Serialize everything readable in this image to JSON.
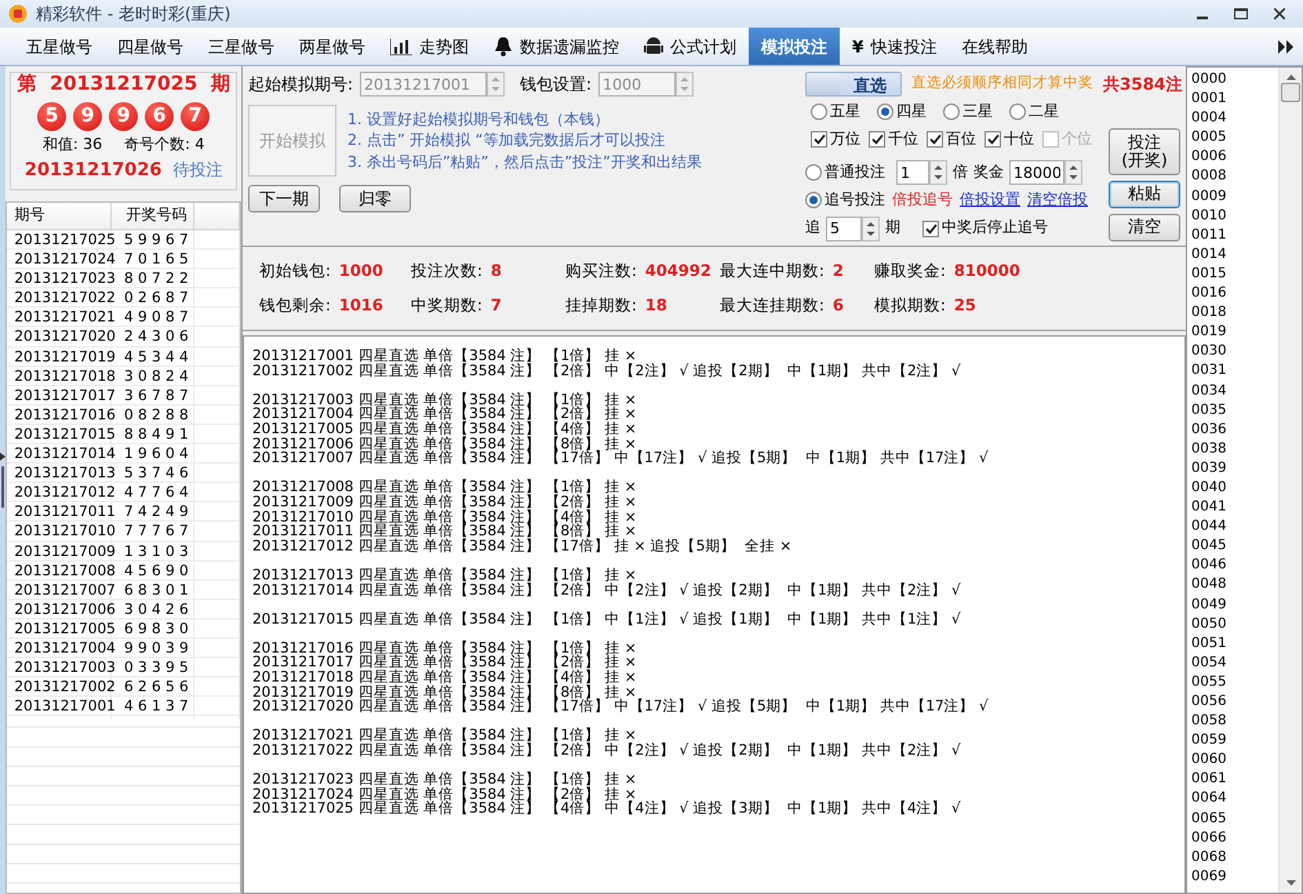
{
  "window": {
    "title": "精彩软件 - 老时时彩(重庆)"
  },
  "menu": [
    {
      "label": "五星做号",
      "kind": "text",
      "selected": false
    },
    {
      "label": "四星做号",
      "kind": "text",
      "selected": false
    },
    {
      "label": "三星做号",
      "kind": "text",
      "selected": false
    },
    {
      "label": "两星做号",
      "kind": "text",
      "selected": false
    },
    {
      "label": "走势图",
      "kind": "chart",
      "selected": false
    },
    {
      "label": "数据遗漏监控",
      "kind": "bell",
      "selected": false
    },
    {
      "label": "公式计划",
      "kind": "robot",
      "selected": false
    },
    {
      "label": "模拟投注",
      "kind": "text",
      "selected": true
    },
    {
      "label": "快速投注",
      "kind": "glyph",
      "glyph": "¥",
      "selected": false
    },
    {
      "label": "在线帮助",
      "kind": "text",
      "selected": false
    }
  ],
  "draw": {
    "prefix": "第",
    "period": "20131217025",
    "suffix": "期",
    "balls": [
      "5",
      "9",
      "9",
      "6",
      "7"
    ],
    "sum_label": "和值:",
    "sum": "36",
    "odd_label": "奇号个数:",
    "odd": "4",
    "next_period": "20131217026",
    "next_status": "待投注"
  },
  "history": {
    "columns": [
      "期号",
      "开奖号码"
    ],
    "rows": [
      {
        "period": "20131217025",
        "numbers": "5 9 9 6 7"
      },
      {
        "period": "20131217024",
        "numbers": "7 0 1 6 5"
      },
      {
        "period": "20131217023",
        "numbers": "8 0 7 2 2"
      },
      {
        "period": "20131217022",
        "numbers": "0 2 6 8 7"
      },
      {
        "period": "20131217021",
        "numbers": "4 9 0 8 7"
      },
      {
        "period": "20131217020",
        "numbers": "2 4 3 0 6"
      },
      {
        "period": "20131217019",
        "numbers": "4 5 3 4 4"
      },
      {
        "period": "20131217018",
        "numbers": "3 0 8 2 4"
      },
      {
        "period": "20131217017",
        "numbers": "3 6 7 8 7"
      },
      {
        "period": "20131217016",
        "numbers": "0 8 2 8 8"
      },
      {
        "period": "20131217015",
        "numbers": "8 8 4 9 1"
      },
      {
        "period": "20131217014",
        "numbers": "1 9 6 0 4"
      },
      {
        "period": "20131217013",
        "numbers": "5 3 7 4 6"
      },
      {
        "period": "20131217012",
        "numbers": "4 7 7 6 4"
      },
      {
        "period": "20131217011",
        "numbers": "7 4 2 4 9"
      },
      {
        "period": "20131217010",
        "numbers": "7 7 7 6 7"
      },
      {
        "period": "20131217009",
        "numbers": "1 3 1 0 3"
      },
      {
        "period": "20131217008",
        "numbers": "4 5 6 9 0"
      },
      {
        "period": "20131217007",
        "numbers": "6 8 3 0 1"
      },
      {
        "period": "20131217006",
        "numbers": "3 0 4 2 6"
      },
      {
        "period": "20131217005",
        "numbers": "6 9 8 3 0"
      },
      {
        "period": "20131217004",
        "numbers": "9 9 0 3 9"
      },
      {
        "period": "20131217003",
        "numbers": "0 3 3 9 5"
      },
      {
        "period": "20131217002",
        "numbers": "6 2 6 5 6"
      },
      {
        "period": "20131217001",
        "numbers": "4 6 1 3 7"
      }
    ]
  },
  "settings": {
    "start_period": {
      "label": "起始模拟期号:",
      "value": "20131217001",
      "disabled": true
    },
    "wallet": {
      "label": "钱包设置:",
      "value": "1000",
      "disabled": true
    },
    "start_button": {
      "label": "开始模拟",
      "disabled": true
    },
    "instructions": [
      "1. 设置好起始模拟期号和钱包（本钱）",
      "2. 点击” 开始模拟 “等加载完数据后才可以投注",
      "3. 杀出号码后”粘贴”，然后点击”投注”开奖和出结果"
    ],
    "next_button": "下一期",
    "reset_button": "归零",
    "mode": {
      "label": "直选",
      "selected": true
    },
    "note": "直选必须顺序相同才算中奖",
    "total": "共3584注",
    "stars": [
      {
        "label": "五星",
        "selected": false
      },
      {
        "label": "四星",
        "selected": true
      },
      {
        "label": "三星",
        "selected": false
      },
      {
        "label": "二星",
        "selected": false
      }
    ],
    "positions": [
      {
        "label": "万位",
        "checked": true,
        "disabled": false
      },
      {
        "label": "千位",
        "checked": true,
        "disabled": false
      },
      {
        "label": "百位",
        "checked": true,
        "disabled": false
      },
      {
        "label": "十位",
        "checked": true,
        "disabled": false
      },
      {
        "label": "个位",
        "checked": false,
        "disabled": true
      }
    ],
    "normal_bet": {
      "label": "普通投注",
      "selected": false,
      "multiplier": "1",
      "times": "倍",
      "prize_label": "奖金",
      "prize": "18000"
    },
    "chase_bet": {
      "label": "追号投注",
      "selected": true,
      "links": [
        {
          "label": "倍投追号",
          "kind": "red"
        },
        {
          "label": "倍投设置",
          "kind": "blue"
        },
        {
          "label": "清空倍投",
          "kind": "blue"
        }
      ]
    },
    "chase": {
      "prefix": "追",
      "value": "5",
      "suffix": "期"
    },
    "stop_on_win": {
      "label": "中奖后停止追号",
      "checked": true
    },
    "buttons": [
      {
        "label": "投注\n(开奖)",
        "focused": false
      },
      {
        "label": "粘贴",
        "focused": true
      },
      {
        "label": "清空",
        "focused": false
      }
    ]
  },
  "stats": [
    {
      "label": "初始钱包:",
      "value": "1000"
    },
    {
      "label": "投注次数:",
      "value": "8"
    },
    {
      "label": "购买注数:",
      "value": "404992"
    },
    {
      "label": "最大连中期数:",
      "value": "2"
    },
    {
      "label": "赚取奖金:",
      "value": "810000"
    },
    {
      "label": "钱包剩余:",
      "value": "1016"
    },
    {
      "label": "中奖期数:",
      "value": "7"
    },
    {
      "label": "挂掉期数:",
      "value": "18"
    },
    {
      "label": "最大连挂期数:",
      "value": "6"
    },
    {
      "label": "模拟期数:",
      "value": "25"
    }
  ],
  "log": [
    [
      "20131217001 四星直选 单倍【3584 注】 【1倍】 挂 ×",
      "20131217002 四星直选 单倍【3584 注】 【2倍】 中【2注】 √ 追投【2期】  中【1期】 共中【2注】 √"
    ],
    [
      "20131217003 四星直选 单倍【3584 注】 【1倍】 挂 ×",
      "20131217004 四星直选 单倍【3584 注】 【2倍】 挂 ×",
      "20131217005 四星直选 单倍【3584 注】 【4倍】 挂 ×",
      "20131217006 四星直选 单倍【3584 注】 【8倍】 挂 ×",
      "20131217007 四星直选 单倍【3584 注】 【17倍】 中【17注】 √ 追投【5期】  中【1期】 共中【17注】 √"
    ],
    [
      "20131217008 四星直选 单倍【3584 注】 【1倍】 挂 ×",
      "20131217009 四星直选 单倍【3584 注】 【2倍】 挂 ×",
      "20131217010 四星直选 单倍【3584 注】 【4倍】 挂 ×",
      "20131217011 四星直选 单倍【3584 注】 【8倍】 挂 ×",
      "20131217012 四星直选 单倍【3584 注】 【17倍】 挂 × 追投【5期】  全挂 ×"
    ],
    [
      "20131217013 四星直选 单倍【3584 注】 【1倍】 挂 ×",
      "20131217014 四星直选 单倍【3584 注】 【2倍】 中【2注】 √ 追投【2期】  中【1期】 共中【2注】 √"
    ],
    [
      "20131217015 四星直选 单倍【3584 注】 【1倍】 中【1注】 √ 追投【1期】  中【1期】 共中【1注】 √"
    ],
    [
      "20131217016 四星直选 单倍【3584 注】 【1倍】 挂 ×",
      "20131217017 四星直选 单倍【3584 注】 【2倍】 挂 ×",
      "20131217018 四星直选 单倍【3584 注】 【4倍】 挂 ×",
      "20131217019 四星直选 单倍【3584 注】 【8倍】 挂 ×",
      "20131217020 四星直选 单倍【3584 注】 【17倍】 中【17注】 √ 追投【5期】  中【1期】 共中【17注】 √"
    ],
    [
      "20131217021 四星直选 单倍【3584 注】 【1倍】 挂 ×",
      "20131217022 四星直选 单倍【3584 注】 【2倍】 中【2注】 √ 追投【2期】  中【1期】 共中【2注】 √"
    ],
    [
      "20131217023 四星直选 单倍【3584 注】 【1倍】 挂 ×",
      "20131217024 四星直选 单倍【3584 注】 【2倍】 挂 ×",
      "20131217025 四星直选 单倍【3584 注】 【4倍】 中【4注】 √ 追投【3期】  中【1期】 共中【4注】 √"
    ]
  ],
  "numbers": [
    "0000",
    "0001",
    "0004",
    "0005",
    "0006",
    "0008",
    "0009",
    "0010",
    "0011",
    "0014",
    "0015",
    "0016",
    "0018",
    "0019",
    "0030",
    "0031",
    "0034",
    "0035",
    "0036",
    "0038",
    "0039",
    "0040",
    "0041",
    "0044",
    "0045",
    "0046",
    "0048",
    "0049",
    "0050",
    "0051",
    "0054",
    "0055",
    "0056",
    "0058",
    "0059",
    "0060",
    "0061",
    "0064",
    "0065",
    "0066",
    "0068",
    "0069"
  ]
}
